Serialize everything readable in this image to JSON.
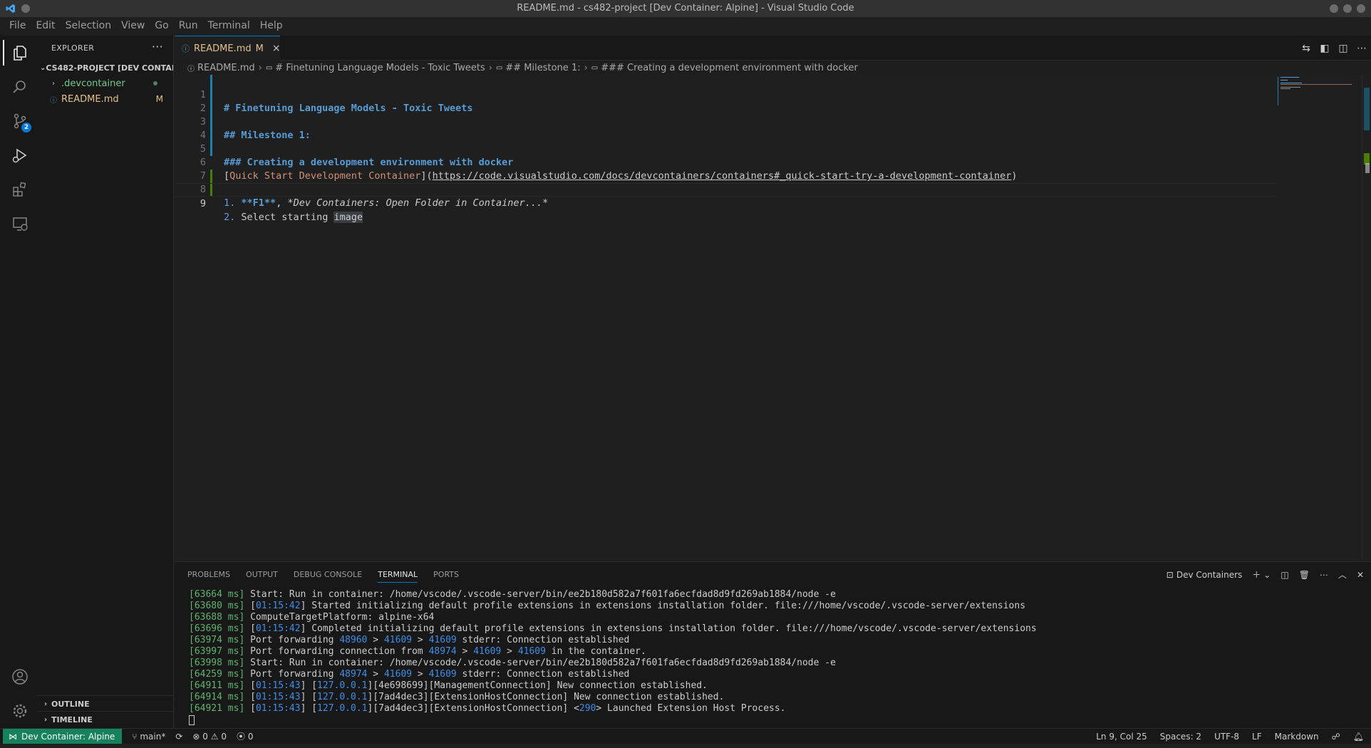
{
  "window": {
    "title": "README.md - cs482-project [Dev Container: Alpine] - Visual Studio Code"
  },
  "menu": [
    "File",
    "Edit",
    "Selection",
    "View",
    "Go",
    "Run",
    "Terminal",
    "Help"
  ],
  "activity": {
    "source_control_badge": "2"
  },
  "sidebar": {
    "header": "EXPLORER",
    "more": "···",
    "root": "CS482-PROJECT [DEV CONTAI...",
    "items": [
      {
        "label": ".devcontainer",
        "color": "#73c991"
      },
      {
        "label": "README.md",
        "mark": "M",
        "color": "#e2c08d"
      }
    ],
    "outline": "OUTLINE",
    "timeline": "TIMELINE"
  },
  "tab": {
    "label": "README.md",
    "mark": "M",
    "close": "×",
    "icon": "ⓘ"
  },
  "breadcrumb": [
    "README.md",
    "# Finetuning Language Models - Toxic Tweets",
    "## Milestone 1:",
    "### Creating a development environment with docker"
  ],
  "editor": {
    "line_numbers": [
      "1",
      "2",
      "3",
      "4",
      "5",
      "6",
      "7",
      "8",
      "9"
    ],
    "l1": "# Finetuning Language Models - Toxic Tweets",
    "l3": "## Milestone 1:",
    "l5": "### Creating a development environment with docker",
    "l6_open": "[",
    "l6_text": "Quick Start Development Container",
    "l6_mid": "](",
    "l6_url": "https://code.visualstudio.com/docs/devcontainers/containers#_quick-start-try-a-development-container",
    "l6_close": ")",
    "l8_num": "1.",
    "l8_bold": "**F1**",
    "l8_sep": ", ",
    "l8_ital": "*Dev Containers: Open Folder in Container...*",
    "l9_num": "2.",
    "l9_text": "Select starting ",
    "l9_hl": "image"
  },
  "panel": {
    "tabs": [
      "PROBLEMS",
      "OUTPUT",
      "DEBUG CONSOLE",
      "TERMINAL",
      "PORTS"
    ],
    "active_tab": "TERMINAL",
    "terminal_name": "Dev Containers",
    "terminal": [
      [
        [
          "g",
          "[63664 ms]"
        ],
        [
          "n",
          " Start: Run in container: /home/vscode/.vscode-server/bin/ee2b180d582a7f601fa6ecfdad8d9fd269ab1884/node -e"
        ]
      ],
      [
        [
          "g",
          "[63680 ms]"
        ],
        [
          "n",
          " ["
        ],
        [
          "b",
          "01:15:42"
        ],
        [
          "n",
          "] Started initializing default profile extensions in extensions installation folder. file:///home/vscode/.vscode-server/extensions"
        ]
      ],
      [
        [
          "g",
          "[63688 ms]"
        ],
        [
          "n",
          " ComputeTargetPlatform: alpine-x64"
        ]
      ],
      [
        [
          "g",
          "[63696 ms]"
        ],
        [
          "n",
          " ["
        ],
        [
          "b",
          "01:15:42"
        ],
        [
          "n",
          "] Completed initializing default profile extensions in extensions installation folder. file:///home/vscode/.vscode-server/extensions"
        ]
      ],
      [
        [
          "g",
          "[63974 ms]"
        ],
        [
          "n",
          " Port forwarding "
        ],
        [
          "b",
          "48960"
        ],
        [
          "n",
          " > "
        ],
        [
          "b",
          "41609"
        ],
        [
          "n",
          " > "
        ],
        [
          "b",
          "41609"
        ],
        [
          "n",
          " stderr: Connection established"
        ]
      ],
      [
        [
          "g",
          "[63997 ms]"
        ],
        [
          "n",
          " Port forwarding connection from "
        ],
        [
          "b",
          "48974"
        ],
        [
          "n",
          " > "
        ],
        [
          "b",
          "41609"
        ],
        [
          "n",
          " > "
        ],
        [
          "b",
          "41609"
        ],
        [
          "n",
          " in the container."
        ]
      ],
      [
        [
          "g",
          "[63998 ms]"
        ],
        [
          "n",
          " Start: Run in container: /home/vscode/.vscode-server/bin/ee2b180d582a7f601fa6ecfdad8d9fd269ab1884/node -e"
        ]
      ],
      [
        [
          "g",
          "[64259 ms]"
        ],
        [
          "n",
          " Port forwarding "
        ],
        [
          "b",
          "48974"
        ],
        [
          "n",
          " > "
        ],
        [
          "b",
          "41609"
        ],
        [
          "n",
          " > "
        ],
        [
          "b",
          "41609"
        ],
        [
          "n",
          " stderr: Connection established"
        ]
      ],
      [
        [
          "g",
          "[64911 ms]"
        ],
        [
          "n",
          " ["
        ],
        [
          "b",
          "01:15:43"
        ],
        [
          "n",
          "] ["
        ],
        [
          "b",
          "127.0.0.1"
        ],
        [
          "n",
          "][4e698699][ManagementConnection] New connection established."
        ]
      ],
      [
        [
          "g",
          "[64914 ms]"
        ],
        [
          "n",
          " ["
        ],
        [
          "b",
          "01:15:43"
        ],
        [
          "n",
          "] ["
        ],
        [
          "b",
          "127.0.0.1"
        ],
        [
          "n",
          "][7ad4dec3][ExtensionHostConnection] New connection established."
        ]
      ],
      [
        [
          "g",
          "[64921 ms]"
        ],
        [
          "n",
          " ["
        ],
        [
          "b",
          "01:15:43"
        ],
        [
          "n",
          "] ["
        ],
        [
          "b",
          "127.0.0.1"
        ],
        [
          "n",
          "][7ad4dec3][ExtensionHostConnection] <"
        ],
        [
          "b",
          "290"
        ],
        [
          "n",
          "> Launched Extension Host Process."
        ]
      ]
    ]
  },
  "status": {
    "remote": "Dev Container: Alpine",
    "branch": "main*",
    "errors": "0",
    "warnings": "0",
    "ports": "0",
    "position": "Ln 9, Col 25",
    "spaces": "Spaces: 2",
    "encoding": "UTF-8",
    "eol": "LF",
    "language": "Markdown"
  },
  "colors": {
    "accent": "#0078d4",
    "remote_bg": "#16825d",
    "modified": "#e2c08d"
  }
}
